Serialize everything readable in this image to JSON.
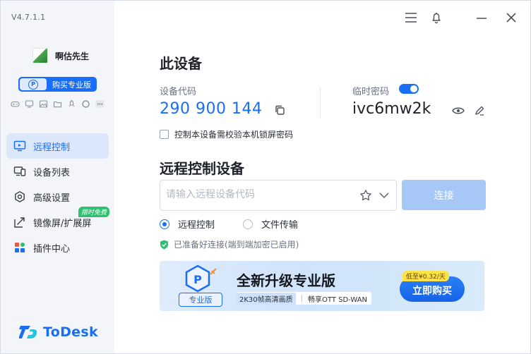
{
  "app": {
    "version": "V4.7.1.1",
    "user_name": "啊估先生",
    "pro_button_label": "购买专业版",
    "pro_chip": "P",
    "brand": "ToDesk"
  },
  "quick_icons": [
    "gamepad-icon",
    "monitor-icon",
    "image-icon",
    "folder-icon",
    "rocket-icon",
    "shield-icon",
    "more-icon"
  ],
  "nav": [
    {
      "label": "远程控制",
      "icon": "remote-control-icon",
      "active": true
    },
    {
      "label": "设备列表",
      "icon": "device-list-icon",
      "active": false
    },
    {
      "label": "高级设置",
      "icon": "settings-icon",
      "active": false
    },
    {
      "label": "镜像屏/扩展屏",
      "icon": "mirror-screen-icon",
      "active": false,
      "badge": "限时免费"
    },
    {
      "label": "插件中心",
      "icon": "plugin-center-icon",
      "active": false
    }
  ],
  "device": {
    "title": "此设备",
    "code_label": "设备代码",
    "code": "290 900 144",
    "temp_pwd_label": "临时密码",
    "temp_pwd": "ivc6mw2k",
    "temp_pwd_enabled": true,
    "lock_check_label": "控制本设备需校验本机锁屏密码",
    "lock_check_checked": false
  },
  "remote": {
    "title": "远程控制设备",
    "input_placeholder": "请输入远程设备代码",
    "input_value": "",
    "connect_label": "连接",
    "modes": [
      {
        "label": "远程控制",
        "selected": true
      },
      {
        "label": "文件传输",
        "selected": false
      }
    ],
    "status": "已准备好连接(端到端加密已启用)"
  },
  "banner": {
    "tag": "专业版",
    "title": "全新升级专业版",
    "feature1": "2K30帧高清画质",
    "feature2": "畅享OTT SD-WAN",
    "price": "低至¥0.32/天",
    "buy_label": "立即购买"
  },
  "colors": {
    "accent": "#1a6ef5",
    "sidebar_bg": "#f3f5f8",
    "connect_disabled": "#a7c8f7",
    "status_ok": "#2fbf71"
  }
}
